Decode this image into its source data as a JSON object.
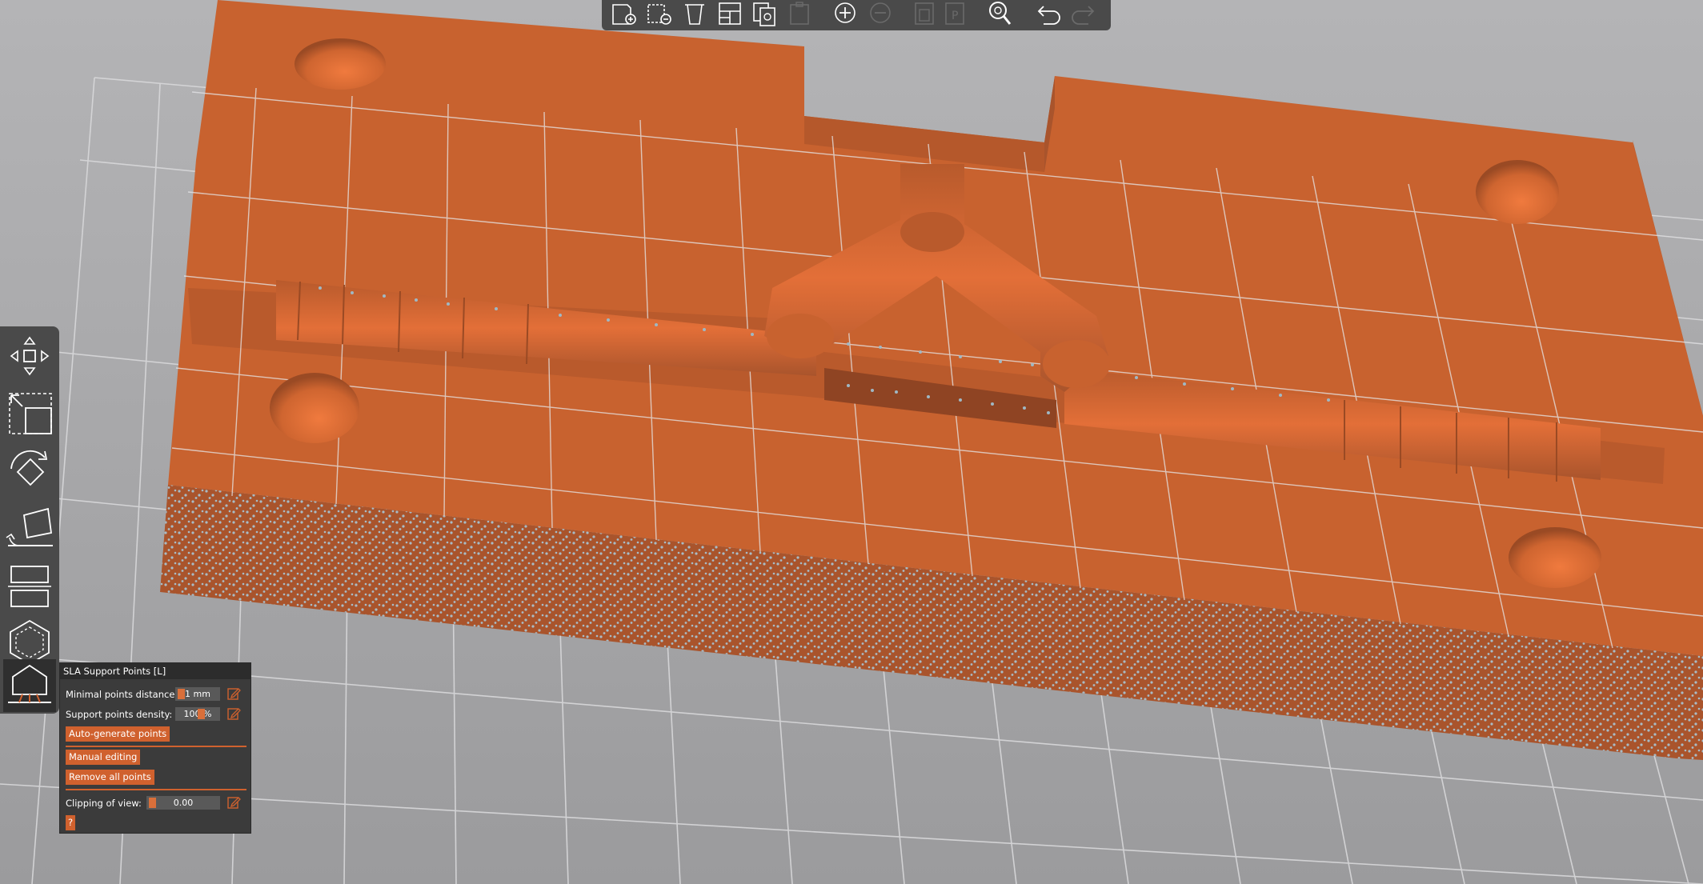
{
  "colors": {
    "accent": "#d0612e",
    "model_top": "#c8622f",
    "model_side": "#a9542c",
    "support_point": "#9fb8c4",
    "panel_bg": "#3b3b3b",
    "toolbar_bg": "#4a4a4a",
    "bed_bg": "#a9a9ab"
  },
  "top_toolbar": {
    "items": [
      {
        "name": "add-icon",
        "enabled": true
      },
      {
        "name": "delete-icon",
        "enabled": true
      },
      {
        "name": "delete-all-icon",
        "enabled": true
      },
      {
        "name": "arrange-icon",
        "enabled": true
      },
      {
        "name": "copy-icon",
        "enabled": true
      },
      {
        "name": "paste-icon",
        "enabled": false
      },
      {
        "name": "add-instance-icon",
        "enabled": true
      },
      {
        "name": "remove-instance-icon",
        "enabled": false
      },
      {
        "name": "split-objects-icon",
        "enabled": false
      },
      {
        "name": "split-parts-icon",
        "enabled": false
      },
      {
        "name": "search-icon",
        "enabled": true
      },
      {
        "name": "undo-icon",
        "enabled": true
      },
      {
        "name": "redo-icon",
        "enabled": false
      }
    ]
  },
  "left_toolbar": {
    "items": [
      {
        "name": "move-icon"
      },
      {
        "name": "scale-icon"
      },
      {
        "name": "rotate-icon"
      },
      {
        "name": "place-on-face-icon"
      },
      {
        "name": "cut-icon"
      },
      {
        "name": "hollow-icon"
      },
      {
        "name": "sla-support-points-icon",
        "active": true
      }
    ]
  },
  "sla_panel": {
    "title": "SLA Support Points [L]",
    "min_distance_label": "Minimal points distance:",
    "min_distance_value": "1 mm",
    "density_label": "Support points density:",
    "density_value": "100 %",
    "auto_generate_label": "Auto-generate points",
    "manual_editing_label": "Manual editing",
    "remove_all_label": "Remove all points",
    "clipping_label": "Clipping of view:",
    "clipping_value": "0.00",
    "help_label": "?"
  }
}
